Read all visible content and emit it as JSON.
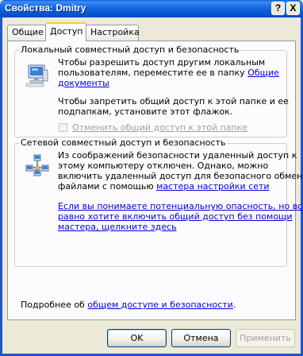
{
  "window": {
    "title": "Свойства: Dmitry",
    "help_button": "?",
    "close_button": "X"
  },
  "tabs": [
    {
      "label": "Общие"
    },
    {
      "label": "Доступ"
    },
    {
      "label": "Настройка"
    }
  ],
  "local": {
    "legend": "Локальный совместный доступ и безопасность",
    "para1_line1": "Чтобы разрешить доступ другим локальным",
    "para1_line2": "пользователям, переместите ее в папку",
    "para1_link_a": "Общие",
    "para1_link_b": "документы",
    "para2_line1": "Чтобы запретить общий доступ к этой папке и ее",
    "para2_line2": "подпапкам, установите этот флажок.",
    "checkbox_label": "Отменить общий доступ к этой папке",
    "checkbox_checked": false
  },
  "network": {
    "legend": "Сетевой совместный доступ и безопасность",
    "para1_line1": "Из соображений безопасности удаленный доступ к",
    "para1_line2": "этому компьютеру отключен. Однако, можно",
    "para1_line3": "включить удаленный доступ для безопасного обмена",
    "para1_line4": "файлами с помощью",
    "para1_link": "мастера настройки сети",
    "para2_link_line1": "Если вы понимаете потенциальную опасность, но все",
    "para2_link_line2": "равно хотите включить общий доступ без помощи",
    "para2_link_line3": "мастера, щелкните здесь"
  },
  "footer": {
    "text": "Подробнее об ",
    "link": "общем доступе и безопасности"
  },
  "buttons": {
    "ok": "OK",
    "cancel": "Отмена",
    "apply": "Применить"
  },
  "colors": {
    "titlebar": "#0A5FD8",
    "dialog_bg": "#ECE9D8",
    "panel_bg": "#FCFCFE",
    "link": "#0000E0",
    "tab_highlight": "#FFC83C"
  },
  "icons": {
    "local": "computer-icon",
    "network": "network-icon"
  }
}
